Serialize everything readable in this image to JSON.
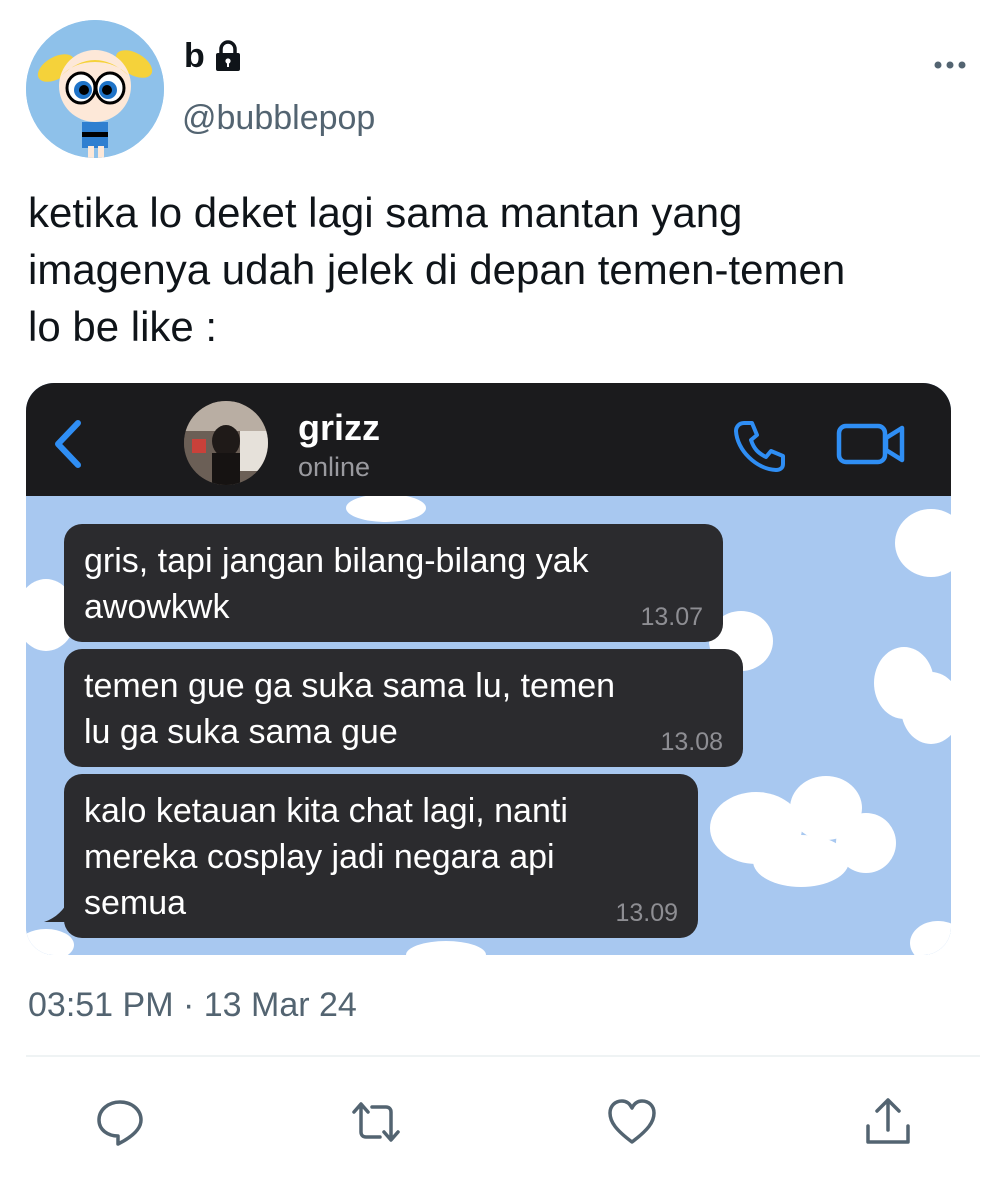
{
  "tweet": {
    "display_name": "b",
    "handle": "@bubblepop",
    "text_lines": [
      "ketika lo deket lagi sama mantan yang",
      "imagenya udah jelek di depan temen-temen",
      "lo be like :"
    ],
    "timestamp": "03:51 PM · 13 Mar 24"
  },
  "chat": {
    "contact_name": "grizz",
    "contact_status": "online",
    "messages": [
      {
        "lines": [
          "gris, tapi jangan bilang-bilang yak",
          "awowkwk"
        ],
        "time": "13.07"
      },
      {
        "lines": [
          "temen gue ga suka sama lu, temen",
          "lu ga suka sama gue"
        ],
        "time": "13.08"
      },
      {
        "lines": [
          "kalo ketauan kita chat lagi, nanti",
          "mereka cosplay jadi negara api",
          "semua"
        ],
        "time": "13.09"
      }
    ]
  },
  "icons": {
    "lock": "lock-icon",
    "more": "more-icon",
    "back": "back-chevron-icon",
    "call": "phone-icon",
    "video": "video-camera-icon",
    "reply": "reply-icon",
    "retweet": "retweet-icon",
    "like": "heart-icon",
    "share": "share-icon"
  },
  "colors": {
    "chat_accent": "#2f8ef4",
    "chat_header_bg": "#1b1b1d",
    "bubble_bg": "#2b2b2e",
    "chat_wallpaper": "#a8c8f0",
    "muted_text": "#536471"
  }
}
